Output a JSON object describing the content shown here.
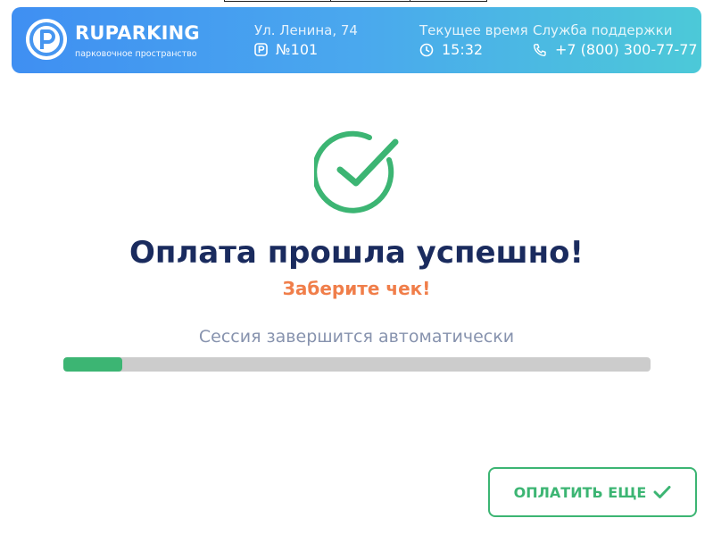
{
  "brand": {
    "name": "RUPARKING",
    "tagline": "парковочное пространство",
    "logo_icon": "parking-pin-icon"
  },
  "header": {
    "address_label": "Ул. Ленина, 74",
    "parking_number": "№101",
    "parking_icon": "parking-sign-icon",
    "time_label": "Текущее время",
    "time_value": "15:32",
    "time_icon": "clock-icon",
    "support_label": "Служба поддержки",
    "support_phone": "+7 (800) 300-77-77",
    "phone_icon": "phone-icon"
  },
  "status": {
    "icon": "success-check-icon",
    "title": "Оплата прошла успешно!",
    "subtitle": "Заберите чек!",
    "session_text": "Сессия завершится автоматически",
    "progress_fraction": 0.1
  },
  "actions": {
    "pay_again_label": "ОПЛАТИТЬ ЕЩЕ",
    "pay_again_icon": "checkmark-icon"
  },
  "colors": {
    "accent_green": "#3cb573",
    "title_navy": "#1a2b5e",
    "subtitle_orange": "#f07e4a",
    "header_gradient_start": "#3f8ff2",
    "header_gradient_end": "#4cc9d8"
  }
}
